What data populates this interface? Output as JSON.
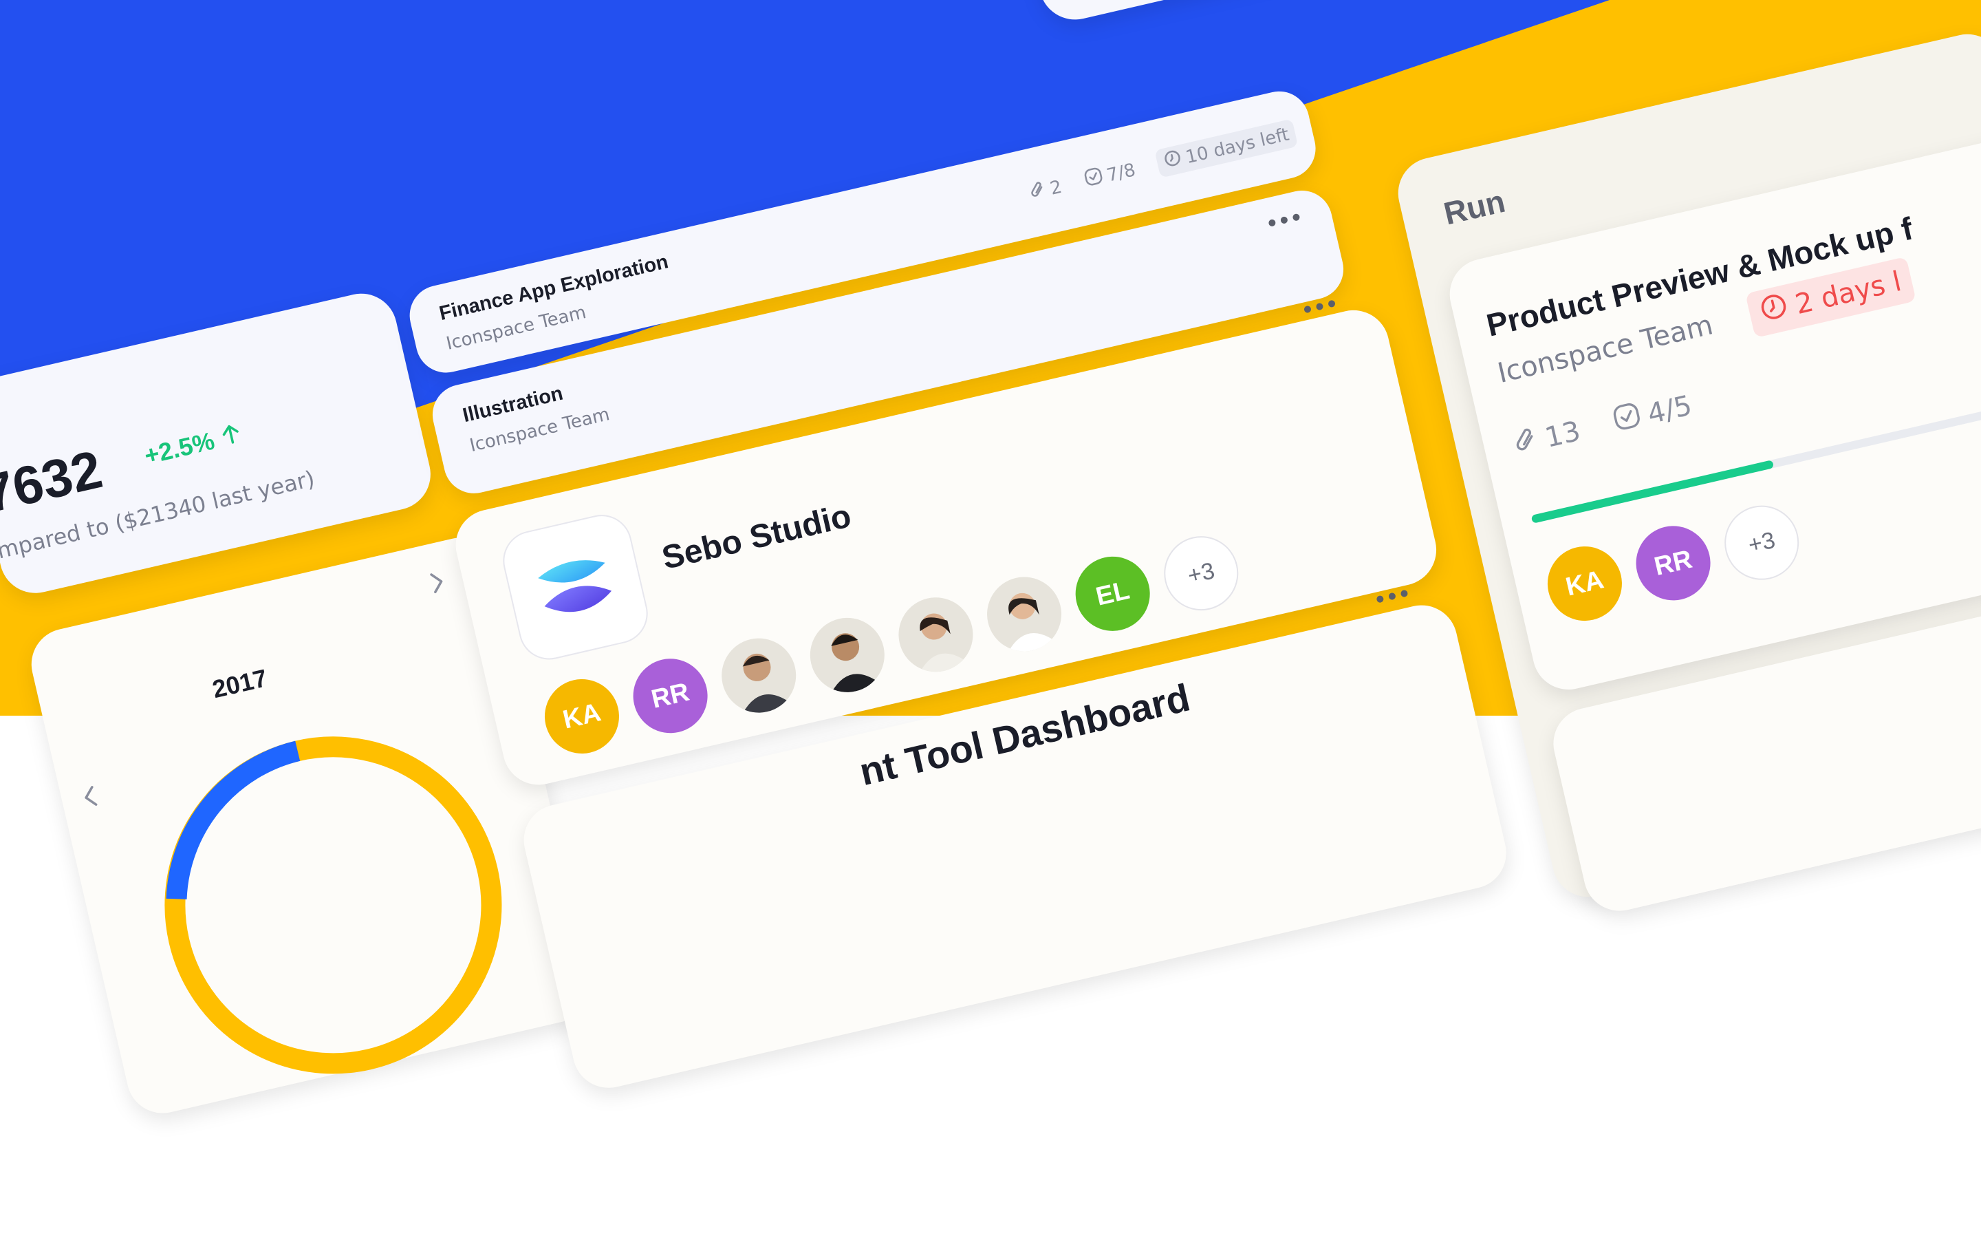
{
  "revenue_card": {
    "amount": "7632",
    "change": "+2.5%",
    "comparison": "mpared to ($21340 last year)",
    "change_color": "#18c47a"
  },
  "calendar_card": {
    "year": "2017",
    "prev_icon": "chevron-left-icon",
    "next_icon": "chevron-right-icon"
  },
  "projects": [
    {
      "title": "Finance App Exploration",
      "team": "Iconspace Team",
      "attachments": "2",
      "tasks": "7/8",
      "deadline": "10 days left"
    },
    {
      "title": "Illustration",
      "team": "Iconspace Team"
    }
  ],
  "studio_card": {
    "name": "Sebo Studio",
    "avatars": [
      {
        "initials": "KA",
        "color": "#f6b800"
      },
      {
        "initials": "RR",
        "color": "#a960d9"
      },
      {
        "initials": "EL",
        "color": "#5cbf25"
      }
    ],
    "more": "+3"
  },
  "dashboard_card": {
    "title": "nt Tool Dashboard"
  },
  "board": {
    "column_title": "Run",
    "task": {
      "title": "Product Preview & Mock up f",
      "team": "Iconspace Team",
      "deadline": "2 days l",
      "attachments": "13",
      "tasks": "4/5",
      "progress": 0.45,
      "avatars": [
        {
          "initials": "KA",
          "color": "#f6b800"
        },
        {
          "initials": "RR",
          "color": "#a960d9"
        }
      ],
      "more": "+3"
    }
  },
  "colors": {
    "blue": "#2350f0",
    "yellow": "#ffc000",
    "progress": "#19cc8c",
    "danger": "#ef4b4b"
  }
}
